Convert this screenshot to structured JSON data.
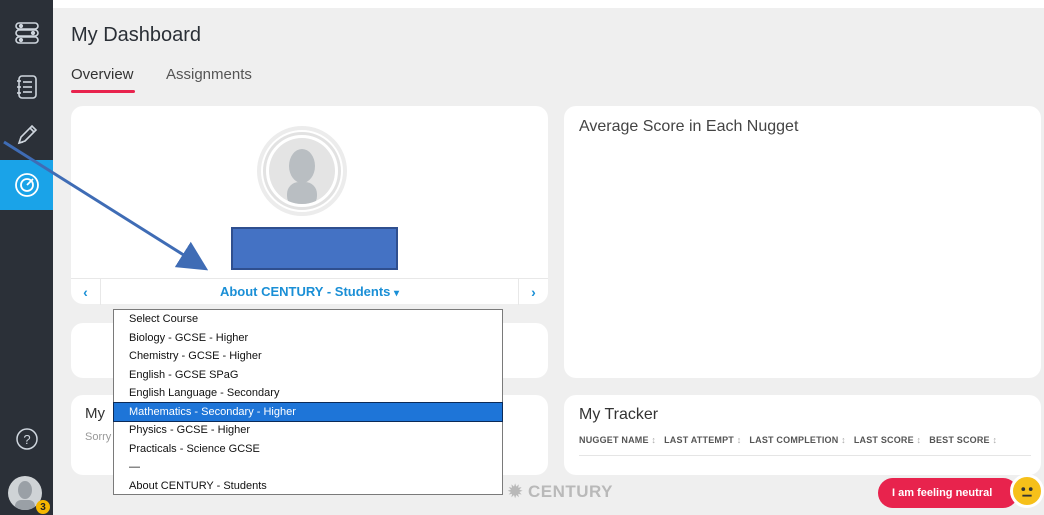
{
  "sidebar": {
    "items": [
      {
        "icon": "pathway-icon"
      },
      {
        "icon": "notebook-icon"
      },
      {
        "icon": "pencil-icon"
      },
      {
        "icon": "dashboard-gauge-icon",
        "active": true
      },
      {
        "icon": "help-icon"
      }
    ],
    "notification_count": "3"
  },
  "header": {
    "title": "My Dashboard",
    "tabs": [
      "Overview",
      "Assignments"
    ]
  },
  "profile": {
    "course": "About CENTURY - Students",
    "prev": "‹",
    "next": "›"
  },
  "my_card": {
    "title": "My",
    "subtitle": "Sorry"
  },
  "average": {
    "title": "Average Score in Each Nugget"
  },
  "tracker": {
    "title": "My Tracker",
    "columns": [
      "NUGGET NAME",
      "LAST ATTEMPT",
      "LAST COMPLETION",
      "LAST SCORE",
      "BEST SCORE"
    ]
  },
  "footer": {
    "logo": "CENTURY",
    "feeling": "I am feeling neutral"
  },
  "course_select": {
    "options": [
      "Select Course",
      "Biology - GCSE - Higher",
      "Chemistry - GCSE - Higher",
      "English - GCSE SPaG",
      "English Language - Secondary",
      "Mathematics - Secondary - Higher",
      "Physics - GCSE - Higher",
      "Practicals - Science GCSE",
      "—",
      "About CENTURY - Students"
    ],
    "highlighted": "Mathematics - Secondary - Higher"
  },
  "colors": {
    "accent": "#1aa3e8",
    "brand_red": "#e8234d",
    "redaction": "#4472c4",
    "highlight": "#1e75d8"
  }
}
